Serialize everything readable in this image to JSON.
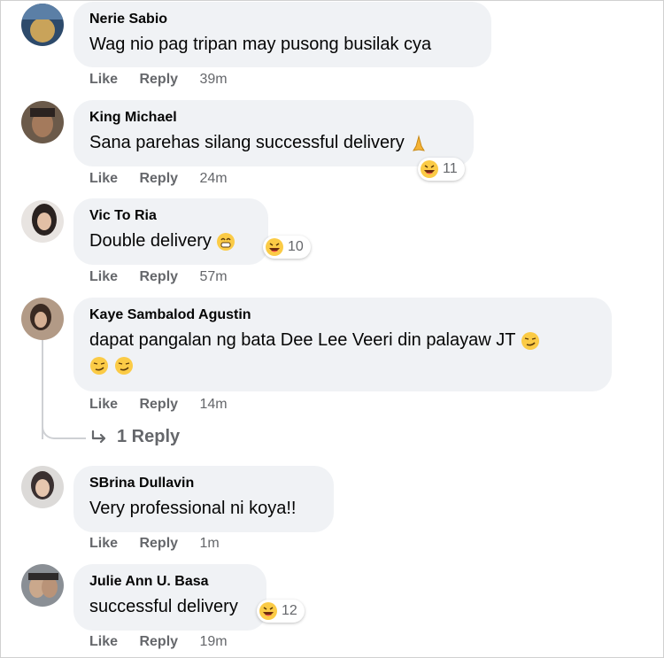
{
  "labels": {
    "like": "Like",
    "reply": "Reply"
  },
  "comments": [
    {
      "author": "Nerie Sabio",
      "text": "Wag nio pag tripan may pusong busilak cya",
      "time": "39m"
    },
    {
      "author": "King Michael",
      "text": "Sana parehas silang successful delivery",
      "text_emoji": "folded-hands",
      "time": "24m",
      "reaction": {
        "icon": "haha-reaction-icon",
        "count": "11"
      }
    },
    {
      "author": "Vic To Ria",
      "text": "Double delivery",
      "text_emoji": "grinning-face",
      "time": "57m",
      "reaction": {
        "icon": "haha-reaction-icon",
        "count": "10"
      }
    },
    {
      "author": "Kaye Sambalod Agustin",
      "text": "dapat pangalan ng bata Dee Lee Veeri din palayaw JT",
      "text_emoji": "smirking-face x3",
      "time": "14m",
      "replies_link": "1 Reply"
    },
    {
      "author": "SBrina Dullavin",
      "text": "Very professional ni koya!!",
      "time": "1m"
    },
    {
      "author": "Julie Ann U. Basa",
      "text": "successful delivery",
      "time": "19m",
      "reaction": {
        "icon": "haha-reaction-icon",
        "count": "12"
      }
    }
  ],
  "colors": {
    "bubble": "#f0f2f5",
    "meta": "#65676b",
    "text": "#050505"
  }
}
